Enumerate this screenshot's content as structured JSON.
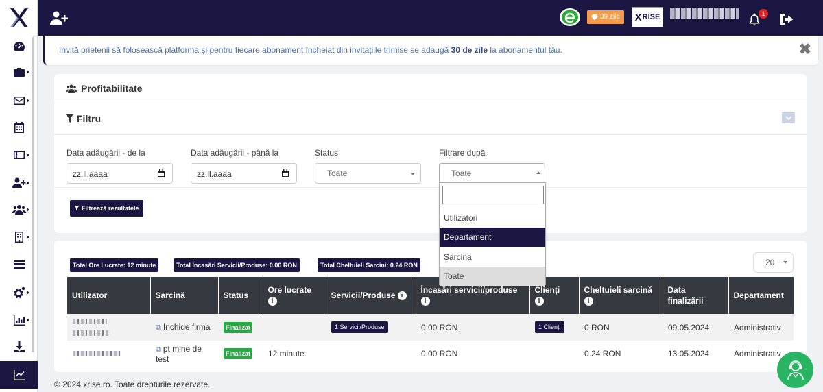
{
  "topbar": {
    "days_badge": "39 zile",
    "brand_text": "RISE",
    "brand_x": "X",
    "notifications_count": "1"
  },
  "banner": {
    "text_before": "Invită prietenii să folosească platforma și pentru fiecare abonament încheiat din invitațiile trimise se adaugă ",
    "text_bold": "30 de zile",
    "text_after": " la abonamentul tău.",
    "close": "✖"
  },
  "card": {
    "title": "Profitabilitate",
    "filter_title": "Filtru"
  },
  "filters": {
    "date_from_label": "Data adăugării - de la",
    "date_from_value": "zz.ll.aaaa",
    "date_to_label": "Data adăugării - până la",
    "date_to_value": "zz.ll.aaaa",
    "status_label": "Status",
    "status_value": "Toate",
    "filter_by_label": "Filtrare după",
    "filter_by_value": "Toate",
    "apply_button": "Filtrează rezultatele"
  },
  "dropdown": {
    "options": [
      "Utilizatori",
      "Departament",
      "Sarcina",
      "Toate"
    ],
    "highlighted": "Departament",
    "selected": "Toate"
  },
  "totals": {
    "hours": "Total Ore Lucrate: 12 minute",
    "income": "Total Încasări Servicii/Produse: 0.00 RON",
    "expenses": "Total Cheltuieli Sarcini: 0.24 RON"
  },
  "page_size": "20",
  "table": {
    "headers": {
      "user": "Utilizator",
      "task": "Sarcină",
      "status": "Status",
      "hours": "Ore lucrate",
      "services": "Servicii/Produse",
      "income": "Încasări servicii/produse",
      "clients": "Clienți",
      "expenses": "Cheltuieli sarcină",
      "date": "Data finalizării",
      "department": "Departament"
    },
    "rows": [
      {
        "task": "Inchide firma",
        "status": "Finalizat",
        "hours": "",
        "services": "1 Servicii/Produse",
        "income": "0.00 RON",
        "clients": "1 Clienți",
        "expenses": "0 RON",
        "date": "09.05.2024",
        "department": "Administrativ"
      },
      {
        "task": "pt mine de test",
        "status": "Finalizat",
        "hours": "12 minute",
        "services": "",
        "income": "0.00 RON",
        "clients": "",
        "expenses": "0.24 RON",
        "date": "13.05.2024",
        "department": "Administrativ"
      }
    ]
  },
  "footer": "© 2024 xrise.ro. Toate drepturile rezervate.",
  "colors": {
    "primary": "#1c1642",
    "success": "#28a745",
    "warning": "#f39c4a",
    "table_header": "#343a40"
  }
}
